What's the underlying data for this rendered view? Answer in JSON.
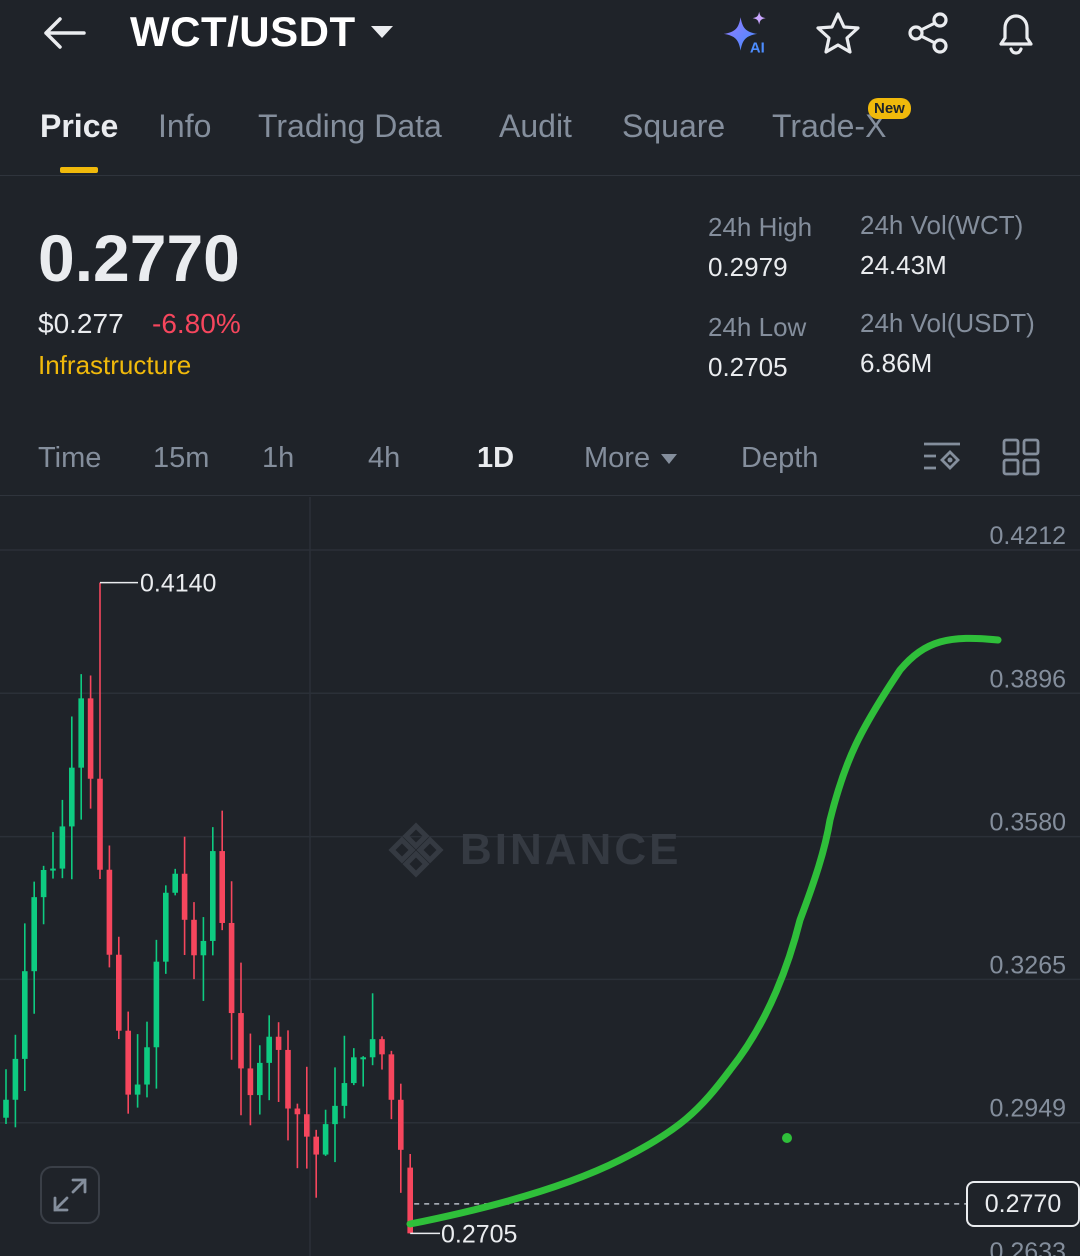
{
  "header": {
    "pair": "WCT/USDT",
    "ai_label": "AI"
  },
  "tabs": [
    {
      "label": "Price",
      "active": true
    },
    {
      "label": "Info"
    },
    {
      "label": "Trading Data"
    },
    {
      "label": "Audit"
    },
    {
      "label": "Square"
    },
    {
      "label": "Trade-X"
    }
  ],
  "new_badge": "New",
  "price": {
    "last": "0.2770",
    "usd": "$0.277",
    "change": "-6.80%",
    "category": "Infrastructure"
  },
  "stats": {
    "high_label": "24h High",
    "high_value": "0.2979",
    "low_label": "24h Low",
    "low_value": "0.2705",
    "vol_base_label": "24h Vol(WCT)",
    "vol_base_value": "24.43M",
    "vol_quote_label": "24h Vol(USDT)",
    "vol_quote_value": "6.86M"
  },
  "intervals": [
    {
      "label": "Time"
    },
    {
      "label": "15m"
    },
    {
      "label": "1h"
    },
    {
      "label": "4h"
    },
    {
      "label": "1D",
      "active": true
    },
    {
      "label": "More"
    },
    {
      "label": "Depth"
    }
  ],
  "chart": {
    "watermark": "BINANCE",
    "y_ticks": [
      "0.4212",
      "0.3896",
      "0.3580",
      "0.3265",
      "0.2949",
      "0.2633"
    ],
    "high_label": "0.4140",
    "low_label": "0.2705",
    "last_tag": "0.2770"
  },
  "colors": {
    "up": "#0ecb81",
    "down": "#f6465d",
    "accent": "#f0b90b",
    "drawing": "#2fbf3a"
  }
}
